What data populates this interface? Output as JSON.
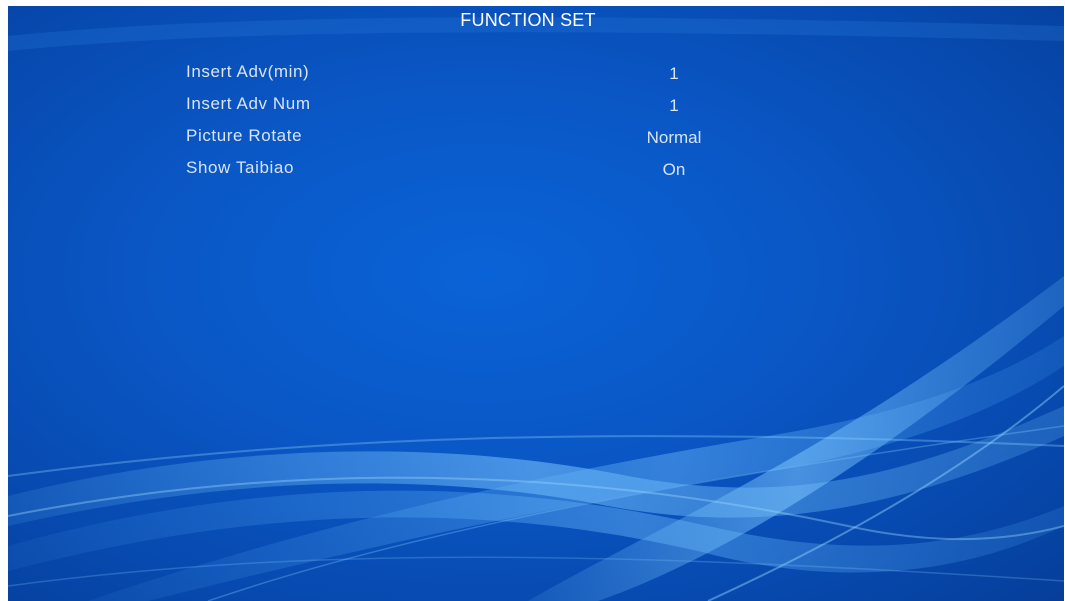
{
  "screen": {
    "title": "FUNCTION SET"
  },
  "menu": {
    "items": [
      {
        "label": "Insert Adv(min)",
        "value": "1"
      },
      {
        "label": "Insert Adv Num",
        "value": "1"
      },
      {
        "label": "Picture Rotate",
        "value": "Normal"
      },
      {
        "label": "Show Taibiao",
        "value": "On"
      }
    ]
  },
  "colors": {
    "background": "#0a5ccc",
    "text": "#d8e4f4",
    "title_text": "#ffffff"
  }
}
